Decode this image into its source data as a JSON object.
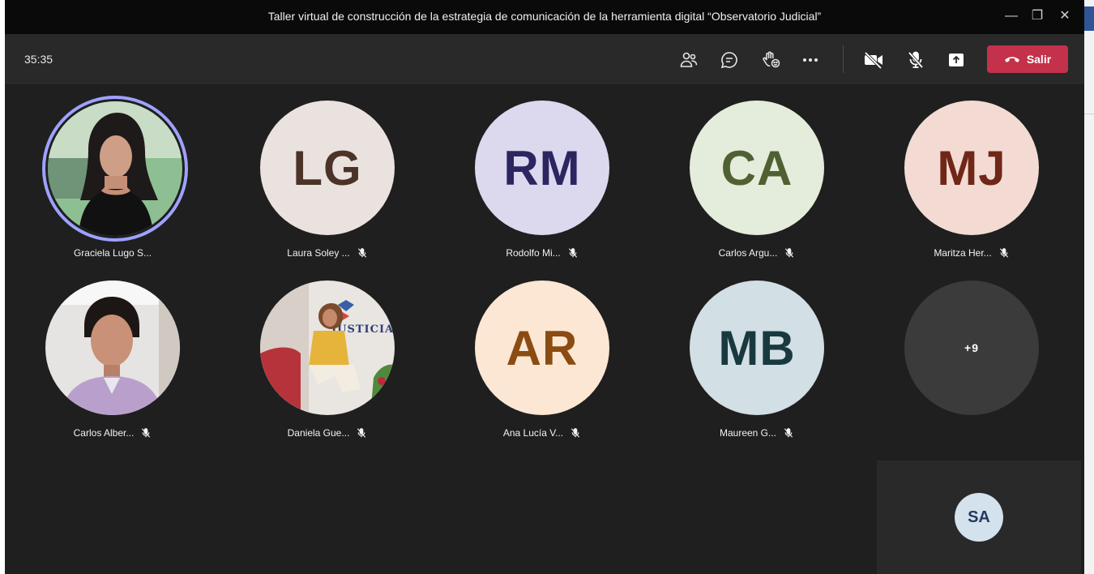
{
  "window": {
    "title": "Taller virtual de construcción de la estrategia de comunicación de la herramienta digital “Observatorio Judicial”",
    "controls": {
      "minimize": "—",
      "maximize": "❐",
      "close": "✕"
    }
  },
  "toolbar": {
    "timer": "35:35",
    "icons": [
      "people-icon",
      "chat-icon",
      "reactions-icon",
      "more-icon",
      "camera-off-icon",
      "mic-off-icon",
      "share-icon"
    ],
    "leave_label": "Salir",
    "leave_color": "#c4314b"
  },
  "participants": [
    {
      "initials": "",
      "name": "Graciela Lugo S...",
      "photo": true,
      "speaking": true,
      "muted": false
    },
    {
      "initials": "LG",
      "name": "Laura Soley ...",
      "bg": "#eae2df",
      "fg": "#4b3328",
      "muted": true
    },
    {
      "initials": "RM",
      "name": "Rodolfo Mi...",
      "bg": "#dcd8ee",
      "fg": "#2b2660",
      "muted": true
    },
    {
      "initials": "CA",
      "name": "Carlos Argu...",
      "bg": "#e4ecdc",
      "fg": "#4f6133",
      "muted": true
    },
    {
      "initials": "MJ",
      "name": "Maritza Her...",
      "bg": "#f3dbd4",
      "fg": "#6f2717",
      "muted": true
    },
    {
      "initials": "",
      "name": "Carlos Alber...",
      "photo": true,
      "muted": true
    },
    {
      "initials": "",
      "name": "Daniela Gue...",
      "photo": true,
      "photo_text": "JUSTICIA ABIERTA",
      "muted": true
    },
    {
      "initials": "AR",
      "name": "Ana Lucía V...",
      "bg": "#fbe7d4",
      "fg": "#8a4c12",
      "muted": true
    },
    {
      "initials": "MB",
      "name": "Maureen G...",
      "bg": "#d2dfe4",
      "fg": "#18393f",
      "muted": true
    },
    {
      "initials": "+9",
      "name": "",
      "bg": "#3b3b3b",
      "fg": "#ffffff",
      "muted": false
    }
  ],
  "self_view": {
    "initials": "SA"
  }
}
